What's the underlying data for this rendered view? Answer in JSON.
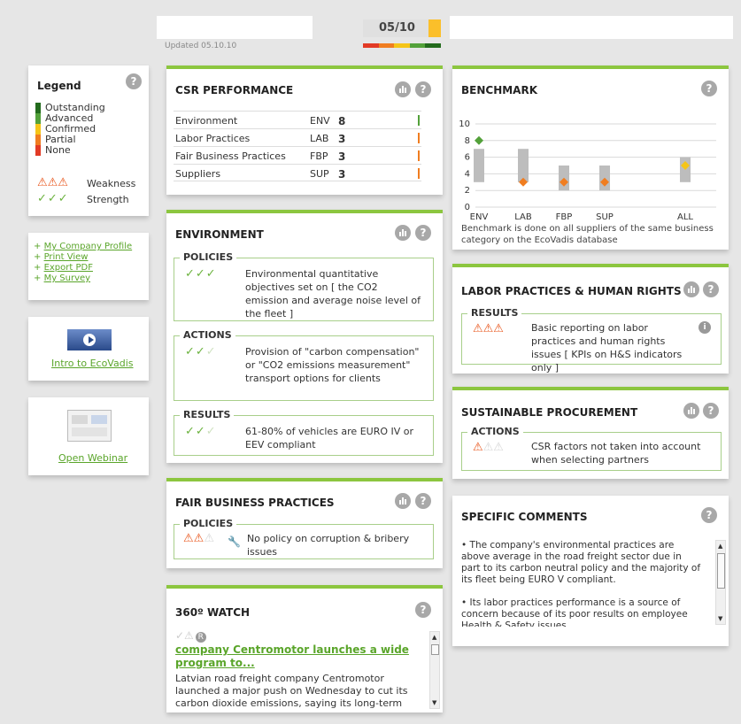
{
  "header": {
    "score": "05/10",
    "updated": "Updated 05.10.10",
    "colors": {
      "accent": "#8cc63f",
      "score_bar": "#fbbf2a",
      "weakness": "#e8541a",
      "strength": "#6cb33f"
    }
  },
  "legend": {
    "title": "Legend",
    "help": "?",
    "levels": [
      {
        "label": "Outstanding",
        "color": "#236b1d"
      },
      {
        "label": "Advanced",
        "color": "#53a13a"
      },
      {
        "label": "Confirmed",
        "color": "#f5c518"
      },
      {
        "label": "Partial",
        "color": "#f07d20"
      },
      {
        "label": "None",
        "color": "#e23a25"
      }
    ],
    "weakness_label": "Weakness",
    "strength_label": "Strength"
  },
  "links": [
    {
      "label": "My Company Profile"
    },
    {
      "label": "Print View"
    },
    {
      "label": "Export PDF"
    },
    {
      "label": "My Survey"
    }
  ],
  "intro": {
    "label": "Intro to EcoVadis"
  },
  "webinar": {
    "label": "Open Webinar"
  },
  "csr": {
    "title": "CSR PERFORMANCE",
    "help": "?",
    "rows": [
      {
        "name": "Environment",
        "code": "ENV",
        "score": "8",
        "color": "#53a13a"
      },
      {
        "name": "Labor Practices",
        "code": "LAB",
        "score": "3",
        "color": "#f07d20"
      },
      {
        "name": "Fair Business Practices",
        "code": "FBP",
        "score": "3",
        "color": "#f07d20"
      },
      {
        "name": "Suppliers",
        "code": "SUP",
        "score": "3",
        "color": "#f07d20"
      }
    ]
  },
  "environment": {
    "title": "ENVIRONMENT",
    "help": "?",
    "policies_label": "POLICIES",
    "policies_text": "Environmental quantitative objectives set on [ the CO2 emission and average noise level of the fleet ]",
    "actions_label": "ACTIONS",
    "actions_text": "Provision of \"carbon compensation\" or \"CO2 emissions measurement\" transport options for clients",
    "results_label": "RESULTS",
    "results_text": "61-80% of vehicles are EURO IV or EEV compliant"
  },
  "fbp": {
    "title": "FAIR BUSINESS PRACTICES",
    "help": "?",
    "policies_label": "POLICIES",
    "policies_text": "No policy on corruption & bribery issues"
  },
  "watch": {
    "title": "360º WATCH",
    "help": "?",
    "headline": "company Centromotor launches a wide program to...",
    "body": "Latvian road freight company Centromotor launched a major push on Wednesday to cut its carbon dioxide emissions, saying its long-term"
  },
  "benchmark": {
    "title": "BENCHMARK",
    "help": "?",
    "note": "Benchmark is done on all suppliers of the same business category on the EcoVadis database"
  },
  "chart_data": {
    "type": "scatter",
    "categories": [
      "ENV",
      "LAB",
      "FBP",
      "SUP",
      "ALL"
    ],
    "ylim": [
      0,
      10
    ],
    "yticks": [
      "0",
      "2",
      "4",
      "6",
      "8",
      "10"
    ],
    "ranges": [
      [
        3,
        7
      ],
      [
        3,
        7
      ],
      [
        2,
        5
      ],
      [
        2,
        5
      ],
      [
        3,
        6
      ]
    ],
    "values": [
      8,
      3,
      3,
      3,
      5
    ],
    "point_colors": [
      "#53a13a",
      "#f07d20",
      "#f07d20",
      "#f07d20",
      "#f5c518"
    ]
  },
  "labor": {
    "title": "LABOR PRACTICES & HUMAN RIGHTS",
    "help": "?",
    "results_label": "RESULTS",
    "results_text": "Basic reporting on labor practices and human rights issues [ KPIs on H&S indicators only ]",
    "info": "i"
  },
  "procurement": {
    "title": "SUSTAINABLE PROCUREMENT",
    "help": "?",
    "actions_label": "ACTIONS",
    "actions_text": "CSR factors not taken into account when selecting partners"
  },
  "comments": {
    "title": "SPECIFIC COMMENTS",
    "help": "?",
    "p1": "• The company's environmental practices are above average in the road freight sector due in part to its carbon neutral policy and the majority of its fleet being EURO V compliant.",
    "p2": "• Its labor practices performance is a source of concern because of its poor results on employee Health & Safety issues"
  }
}
